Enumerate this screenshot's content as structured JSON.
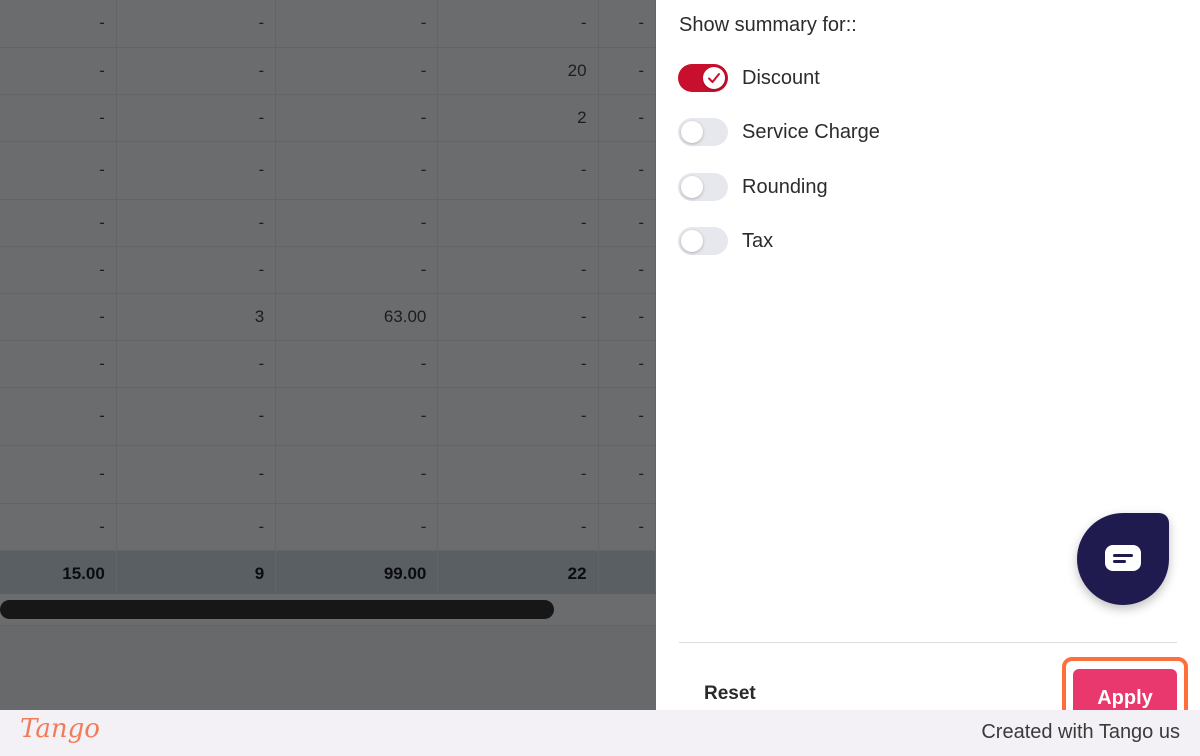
{
  "table": {
    "rows": [
      [
        "-",
        "-",
        "-",
        "-",
        "-"
      ],
      [
        "-",
        "-",
        "-",
        "20",
        "-"
      ],
      [
        "-",
        "-",
        "-",
        "2",
        "-"
      ],
      [
        "-",
        "-",
        "-",
        "-",
        "-"
      ],
      [
        "-",
        "-",
        "-",
        "-",
        "-"
      ],
      [
        "-",
        "-",
        "-",
        "-",
        "-"
      ],
      [
        "-",
        "3",
        "63.00",
        "-",
        "-"
      ],
      [
        "-",
        "-",
        "-",
        "-",
        "-"
      ],
      [
        "-",
        "-",
        "-",
        "-",
        "-"
      ],
      [
        "-",
        "-",
        "-",
        "-",
        "-"
      ],
      [
        "-",
        "-",
        "-",
        "-",
        "-"
      ]
    ],
    "totals": [
      "15.00",
      "9",
      "99.00",
      "22",
      ""
    ]
  },
  "panel": {
    "heading": "Show summary for::",
    "toggles": [
      {
        "label": "Discount",
        "on": true
      },
      {
        "label": "Service Charge",
        "on": false
      },
      {
        "label": "Rounding",
        "on": false
      },
      {
        "label": "Tax",
        "on": false
      }
    ],
    "reset_label": "Reset",
    "apply_label": "Apply"
  },
  "footer": {
    "logo_text": "Tango",
    "credit_text": "Created with Tango us"
  },
  "colors": {
    "toggle_on": "#c8102e",
    "apply_button": "#e8386d",
    "highlight": "#ff6f3c",
    "chat_button": "#1f1b4e"
  },
  "icons": {
    "chat": "chat-bubble-icon",
    "check": "check-icon"
  }
}
